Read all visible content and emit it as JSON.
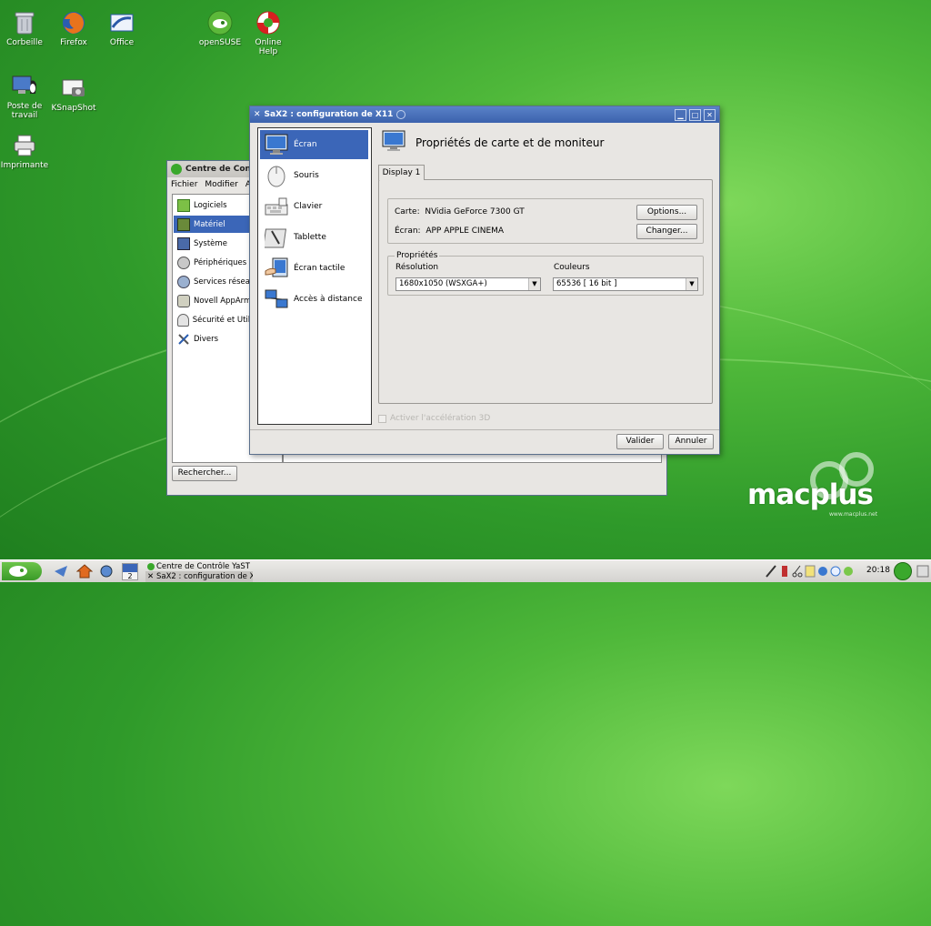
{
  "desktop": {
    "icons": [
      {
        "label": "Corbeille",
        "icon": "trash-icon"
      },
      {
        "label": "Firefox",
        "icon": "firefox-icon"
      },
      {
        "label": "Office",
        "icon": "office-icon"
      },
      {
        "label": "openSUSE",
        "icon": "opensuse-icon"
      },
      {
        "label": "Online\nHelp",
        "icon": "lifebuoy-icon"
      },
      {
        "label": "Poste de\ntravail",
        "icon": "computer-icon"
      },
      {
        "label": "KSnapShot",
        "icon": "camera-icon"
      },
      {
        "label": "Imprimante",
        "icon": "printer-icon"
      }
    ],
    "watermark": {
      "brand": "macplus",
      "url": "www.macplus.net"
    }
  },
  "yast": {
    "title": "Centre de Contrôle YaST",
    "menu": [
      "Fichier",
      "Modifier",
      "Aide"
    ],
    "categories": [
      {
        "label": "Logiciels",
        "icon": "software-icon"
      },
      {
        "label": "Matériel",
        "icon": "hardware-icon"
      },
      {
        "label": "Système",
        "icon": "system-icon"
      },
      {
        "label": "Périphériques réseau",
        "icon": "network-devices-icon"
      },
      {
        "label": "Services réseau",
        "icon": "network-services-icon"
      },
      {
        "label": "Novell AppArmor",
        "icon": "apparmor-icon"
      },
      {
        "label": "Sécurité et Utilisateurs",
        "icon": "security-icon"
      },
      {
        "label": "Divers",
        "icon": "misc-icon"
      }
    ],
    "selected_category": "Matériel",
    "search_label": "Rechercher..."
  },
  "sax2": {
    "title": "SaX2 : configuration de X11",
    "nav": [
      {
        "label": "Écran",
        "icon": "monitor-icon"
      },
      {
        "label": "Souris",
        "icon": "mouse-icon"
      },
      {
        "label": "Clavier",
        "icon": "keyboard-icon"
      },
      {
        "label": "Tablette",
        "icon": "tablet-icon"
      },
      {
        "label": "Écran tactile",
        "icon": "touchscreen-icon"
      },
      {
        "label": "Accès à distance",
        "icon": "remote-access-icon"
      }
    ],
    "selected_nav": "Écran",
    "heading": "Propriétés de carte et de moniteur",
    "tab": "Display 1",
    "card_label": "Carte:",
    "card_value": "NVidia GeForce 7300 GT",
    "screen_label": "Écran:",
    "screen_value": "APP APPLE CINEMA",
    "options_button": "Options...",
    "change_button": "Changer...",
    "properties_group": "Propriétés",
    "resolution_label": "Résolution",
    "resolution_value": "1680x1050 (WSXGA+)",
    "colors_label": "Couleurs",
    "colors_value": "65536 [ 16 bit ]",
    "accel_checkbox": "Activer l'accélération 3D",
    "accel_checked": false,
    "ok_button": "Valider",
    "cancel_button": "Annuler"
  },
  "taskbar": {
    "desktop_number": "2",
    "tasks": [
      "Centre de Contrôle YaST",
      "SaX2 : configuration de X11"
    ],
    "clock": "20:18"
  },
  "colors": {
    "selection": "#3b66b8",
    "titlebar_active": "#4a72bd",
    "desktop_green": "#3fae34"
  }
}
